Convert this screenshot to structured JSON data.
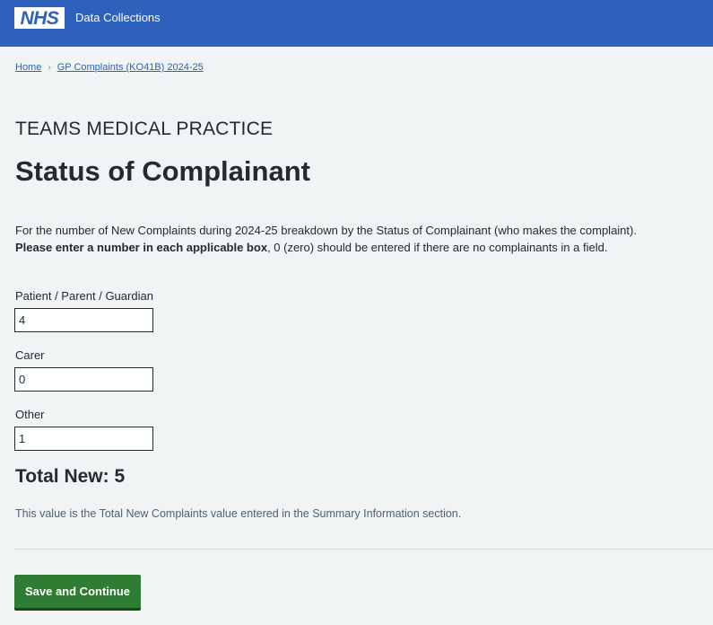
{
  "header": {
    "logo_text": "NHS",
    "service_name": "Data Collections",
    "brand_color": "#2d61bc"
  },
  "breadcrumb": {
    "home": "Home",
    "separator_icon": "chevron-right-icon",
    "current": "GP Complaints (KO41B) 2024-25"
  },
  "page": {
    "caption": "TEAMS MEDICAL PRACTICE",
    "title": "Status of Complainant",
    "intro_text": "For the number of New Complaints during 2024-25 breakdown by the Status of Complainant (who makes the complaint).",
    "instruction_bold": "Please enter a number in each applicable box",
    "instruction_rest": ", 0 (zero) should be entered if there are no complainants in a field."
  },
  "fields": [
    {
      "label": "Patient / Parent / Guardian",
      "value": "4"
    },
    {
      "label": "Carer",
      "value": "0"
    },
    {
      "label": "Other",
      "value": "1"
    }
  ],
  "total": {
    "text": "Total New: 5",
    "hint": "This value is the Total New Complaints value entered in the Summary Information section."
  },
  "actions": {
    "save_label": "Save and Continue",
    "button_color": "#2f7d32"
  }
}
